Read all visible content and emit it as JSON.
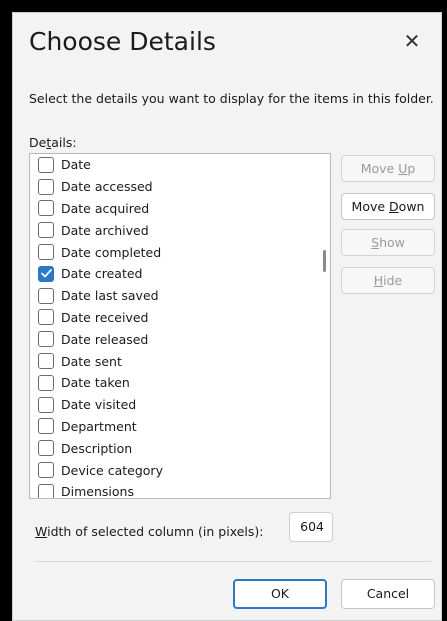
{
  "window": {
    "title": "Choose Details",
    "close_glyph": "✕"
  },
  "description": "Select the details you want to display for the items in this folder.",
  "details_label": {
    "pre": "De",
    "accel": "t",
    "post": "ails:"
  },
  "details_list": [
    {
      "label": "Date",
      "checked": false
    },
    {
      "label": "Date accessed",
      "checked": false
    },
    {
      "label": "Date acquired",
      "checked": false
    },
    {
      "label": "Date archived",
      "checked": false
    },
    {
      "label": "Date completed",
      "checked": false
    },
    {
      "label": "Date created",
      "checked": true
    },
    {
      "label": "Date last saved",
      "checked": false
    },
    {
      "label": "Date received",
      "checked": false
    },
    {
      "label": "Date released",
      "checked": false
    },
    {
      "label": "Date sent",
      "checked": false
    },
    {
      "label": "Date taken",
      "checked": false
    },
    {
      "label": "Date visited",
      "checked": false
    },
    {
      "label": "Department",
      "checked": false
    },
    {
      "label": "Description",
      "checked": false
    },
    {
      "label": "Device category",
      "checked": false
    },
    {
      "label": "Dimensions",
      "checked": false
    }
  ],
  "buttons": {
    "move_up": {
      "pre": "Move ",
      "accel": "U",
      "post": "p",
      "enabled": false
    },
    "move_down": {
      "pre": "Move ",
      "accel": "D",
      "post": "own",
      "enabled": true
    },
    "show": {
      "pre": "",
      "accel": "S",
      "post": "how",
      "enabled": false
    },
    "hide": {
      "pre": "",
      "accel": "H",
      "post": "ide",
      "enabled": false
    }
  },
  "width_field": {
    "label_accel": "W",
    "label_rest": "idth of selected column (in pixels):",
    "value": "604"
  },
  "footer": {
    "ok": "OK",
    "cancel": "Cancel"
  },
  "colors": {
    "accent": "#2b78c5",
    "dialog_bg": "#f3f3f3",
    "disabled_text": "#9a9a9a"
  }
}
